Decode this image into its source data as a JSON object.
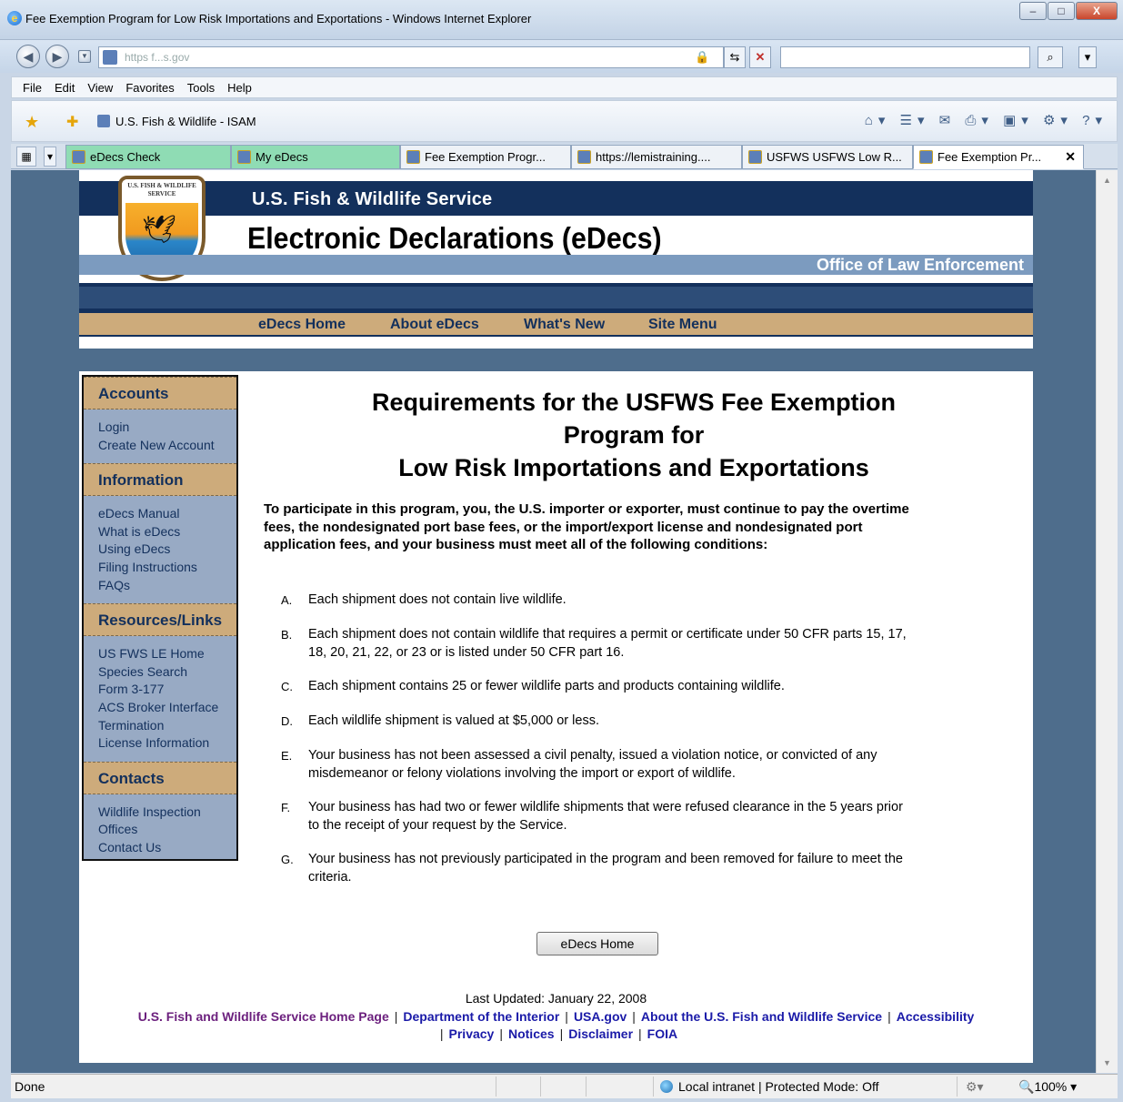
{
  "window": {
    "title": "Fee Exemption Program for Low Risk Importations and Exportations - Windows Internet Explorer",
    "minimize": "–",
    "maximize": "□",
    "close": "X"
  },
  "address": {
    "url": "https   f...s.gov",
    "back_icon": "back-arrow-icon",
    "forward_icon": "forward-arrow-icon"
  },
  "menu": [
    "File",
    "Edit",
    "View",
    "Favorites",
    "Tools",
    "Help"
  ],
  "favorites_bar": {
    "site": "U.S. Fish & Wildlife - ISAM"
  },
  "tabs": [
    {
      "label": "eDecs Check",
      "style": "green"
    },
    {
      "label": "My eDecs",
      "style": "green"
    },
    {
      "label": "Fee Exemption Progr...",
      "style": "plain"
    },
    {
      "label": "https://lemistraining....",
      "style": "plain"
    },
    {
      "label": "USFWS USFWS Low R...",
      "style": "plain"
    },
    {
      "label": "Fee Exemption Pr...",
      "style": "active"
    }
  ],
  "banner": {
    "seal_text": "U.S. FISH & WILDLIFE SERVICE",
    "agency": "U.S. Fish & Wildlife Service",
    "title": "Electronic Declarations (eDecs)",
    "office": "Office of Law Enforcement",
    "nav": [
      "eDecs Home",
      "About eDecs",
      "What's New",
      "Site Menu"
    ]
  },
  "sidebar": {
    "sections": [
      {
        "heading": "Accounts",
        "links": [
          "Login",
          "Create New Account"
        ]
      },
      {
        "heading": "Information",
        "links": [
          "eDecs Manual",
          "What is eDecs",
          "Using eDecs",
          "Filing Instructions",
          "FAQs"
        ]
      },
      {
        "heading": "Resources/Links",
        "links": [
          "US FWS LE Home",
          "Species Search",
          "Form 3-177",
          "ACS Broker Interface",
          "Termination",
          "License Information"
        ]
      },
      {
        "heading": "Contacts",
        "links": [
          "Wildlife Inspection",
          "Offices",
          "Contact Us"
        ]
      }
    ]
  },
  "main": {
    "heading_line1": "Requirements for the USFWS Fee Exemption",
    "heading_line2": "Program for",
    "heading_line3": "Low Risk Importations and Exportations",
    "intro": "To participate in this program, you, the U.S. importer or exporter, must continue to pay the overtime fees, the nondesignated port base fees, or the import/export license and nondesignated port application fees, and your business must meet all of the following conditions:",
    "requirements": [
      {
        "letter": "A.",
        "text": "Each shipment does not contain live wildlife."
      },
      {
        "letter": "B.",
        "text": "Each shipment does not contain wildlife that requires a permit or certificate under 50 CFR parts 15, 17, 18, 20, 21, 22, or 23 or is listed under 50 CFR part 16."
      },
      {
        "letter": "C.",
        "text": "Each shipment contains 25 or fewer wildlife parts and products containing wildlife."
      },
      {
        "letter": "D.",
        "text": "Each wildlife shipment is valued at $5,000 or less."
      },
      {
        "letter": "E.",
        "text": "Your business has not been assessed a civil penalty, issued a violation notice, or convicted of any misdemeanor or felony violations involving the import or export of wildlife."
      },
      {
        "letter": "F.",
        "text": "Your business has had two or fewer wildlife shipments that were refused clearance in the 5 years prior to the receipt of your request by the Service."
      },
      {
        "letter": "G.",
        "text": "Your business has not previously participated in the program and been removed for failure to meet the criteria."
      }
    ],
    "home_button": "eDecs Home"
  },
  "footer": {
    "updated": "Last Updated: January 22, 2008",
    "links": [
      "U.S. Fish and Wildlife Service Home Page",
      "Department of the Interior",
      "USA.gov",
      "About the U.S. Fish and Wildlife Service",
      "Accessibility",
      "Privacy",
      "Notices",
      "Disclaimer",
      "FOIA"
    ],
    "separator": "|"
  },
  "status": {
    "text": "Done",
    "zone": "Local intranet | Protected Mode: Off",
    "zoom": "100%"
  }
}
